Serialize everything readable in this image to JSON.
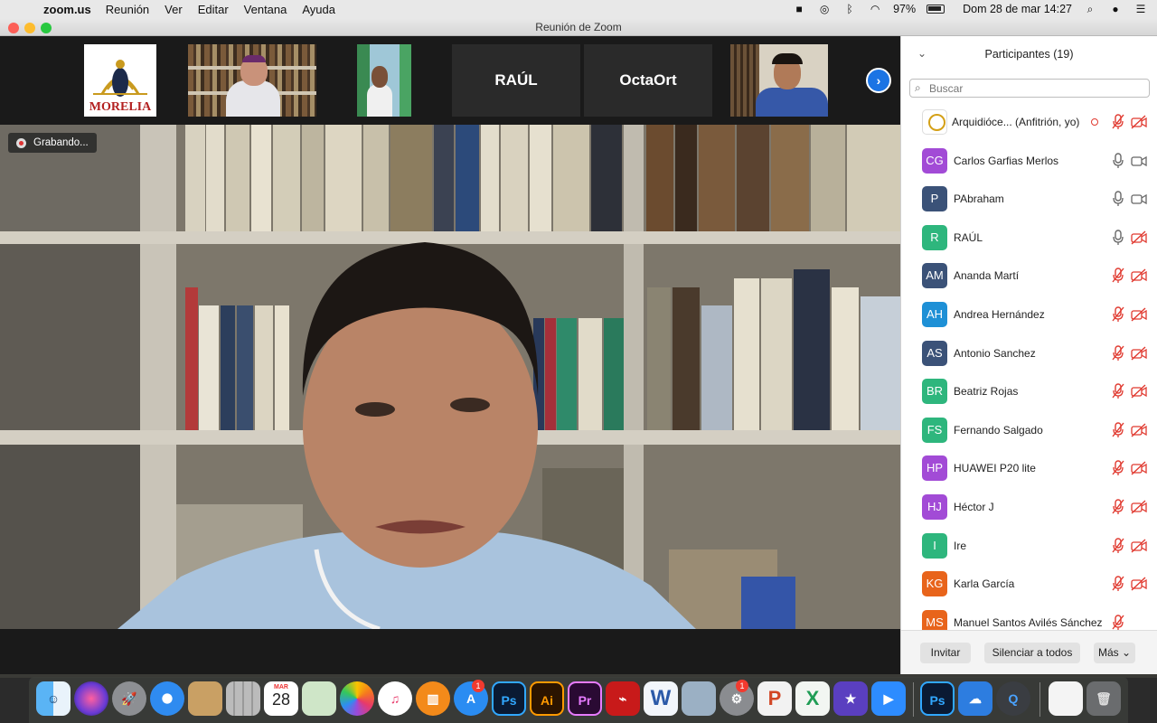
{
  "menubar": {
    "app_name": "zoom.us",
    "menus": [
      "Reunión",
      "Ver",
      "Editar",
      "Ventana",
      "Ayuda"
    ],
    "battery_percent": "97%",
    "datetime": "Dom 28 de mar  14:27"
  },
  "window": {
    "title": "Reunión de Zoom"
  },
  "thumbnails": [
    {
      "name": "",
      "kind": "logo",
      "logo_text": "MORELIA"
    },
    {
      "name": "",
      "kind": "video"
    },
    {
      "name": "",
      "kind": "video"
    },
    {
      "name": "RAÚL",
      "kind": "name"
    },
    {
      "name": "OctaOrt",
      "kind": "name"
    },
    {
      "name": "",
      "kind": "video"
    }
  ],
  "recording": {
    "label": "Grabando..."
  },
  "participants_panel": {
    "title": "Participantes (19)",
    "search_placeholder": "Buscar",
    "participants": [
      {
        "initials": "",
        "name": "Arquidióce...   (Anfitrión, yo)",
        "color": "#ffffff",
        "mic": "muted",
        "video": "off",
        "logo": true
      },
      {
        "initials": "CG",
        "name": "Carlos Garfias Merlos",
        "color": "#a24bd6",
        "mic": "on",
        "video": "on"
      },
      {
        "initials": "P",
        "name": "PAbraham",
        "color": "#3b5278",
        "mic": "on",
        "video": "on"
      },
      {
        "initials": "R",
        "name": "RAÚL",
        "color": "#2eb67d",
        "mic": "on",
        "video": "off"
      },
      {
        "initials": "AM",
        "name": "Ananda Martí",
        "color": "#3b5278",
        "mic": "muted",
        "video": "off"
      },
      {
        "initials": "AH",
        "name": "Andrea Hernández",
        "color": "#1e90d6",
        "mic": "muted",
        "video": "off"
      },
      {
        "initials": "AS",
        "name": "Antonio Sanchez",
        "color": "#3b5278",
        "mic": "muted",
        "video": "off"
      },
      {
        "initials": "BR",
        "name": "Beatriz Rojas",
        "color": "#2eb67d",
        "mic": "muted",
        "video": "off"
      },
      {
        "initials": "FS",
        "name": "Fernando Salgado",
        "color": "#2eb67d",
        "mic": "muted",
        "video": "off"
      },
      {
        "initials": "HP",
        "name": "HUAWEI P20 lite",
        "color": "#a24bd6",
        "mic": "muted",
        "video": "off"
      },
      {
        "initials": "HJ",
        "name": "Héctor J",
        "color": "#a24bd6",
        "mic": "muted",
        "video": "off"
      },
      {
        "initials": "I",
        "name": "Ire",
        "color": "#2eb67d",
        "mic": "muted",
        "video": "off"
      },
      {
        "initials": "KG",
        "name": "Karla García",
        "color": "#e8641b",
        "mic": "muted",
        "video": "off"
      },
      {
        "initials": "MS",
        "name": "Manuel Santos Avilés Sánchez",
        "color": "#e8641b",
        "mic": "muted",
        "video": "none"
      }
    ],
    "footer": {
      "invite": "Invitar",
      "mute_all": "Silenciar a todos",
      "more": "Más"
    }
  },
  "dock": {
    "calendar_month": "MAR",
    "calendar_day": "28",
    "badges": {
      "app_store": "1",
      "system_preferences": "1"
    }
  }
}
